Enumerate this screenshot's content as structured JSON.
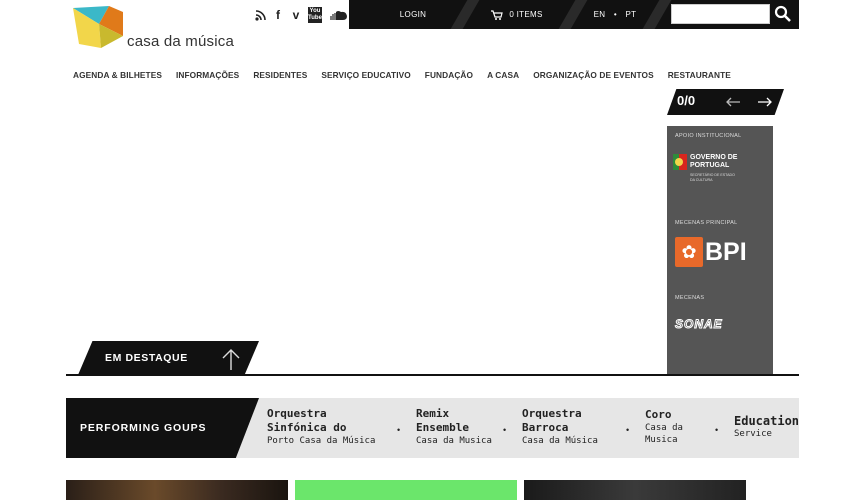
{
  "brand": {
    "name": "casa da música"
  },
  "social": [
    "rss-icon",
    "facebook-icon",
    "vimeo-icon",
    "youtube-icon",
    "soundcloud-icon"
  ],
  "social_labels": {
    "youtube": "You Tube"
  },
  "topbar": {
    "login": "LOGIN",
    "cart": "0 ITEMS",
    "lang_en": "EN",
    "lang_sep": "•",
    "lang_pt": "PT",
    "search_placeholder": ""
  },
  "nav": [
    "AGENDA & BILHETES",
    "INFORMAÇÕES",
    "RESIDENTES",
    "SERVIÇO EDUCATIVO",
    "FUNDAÇÃO",
    "A CASA",
    "ORGANIZAÇÃO DE EVENTOS",
    "RESTAURANTE"
  ],
  "slider": {
    "counter": "0/0"
  },
  "sponsors": {
    "institutional_label": "APOIO INSTITUCIONAL",
    "gov_line1": "GOVERNO DE",
    "gov_line2": "PORTUGAL",
    "gov_line3": "SECRETÁRIO DE ESTADO",
    "gov_line4": "DA CULTURA",
    "main_label": "MECENAS PRINCIPAL",
    "bpi": "BPI",
    "mecenas_label": "MECENAS",
    "sonae": "SONAE"
  },
  "destaque": {
    "label": "EM DESTAQUE"
  },
  "groups": {
    "title": "PERFORMING GOUPS",
    "items": [
      {
        "line1": "Orquestra",
        "line2": "Sinfónica do",
        "sub": "Porto Casa da Música"
      },
      {
        "line1": "Remix",
        "line2": "Ensemble",
        "sub": "Casa da Musica"
      },
      {
        "line1": "Orquestra",
        "line2": "Barroca",
        "sub": "Casa da Música"
      },
      {
        "line1": "Coro",
        "sub1": "Casa da",
        "sub2": "Musica"
      },
      {
        "line1": "Education",
        "sub": "Service"
      }
    ],
    "separator": "•"
  },
  "colors": {
    "dark": "#111111",
    "sponsor_bg": "#555555",
    "groups_bg": "#e6e6e6",
    "green_tile": "#6be66b"
  }
}
